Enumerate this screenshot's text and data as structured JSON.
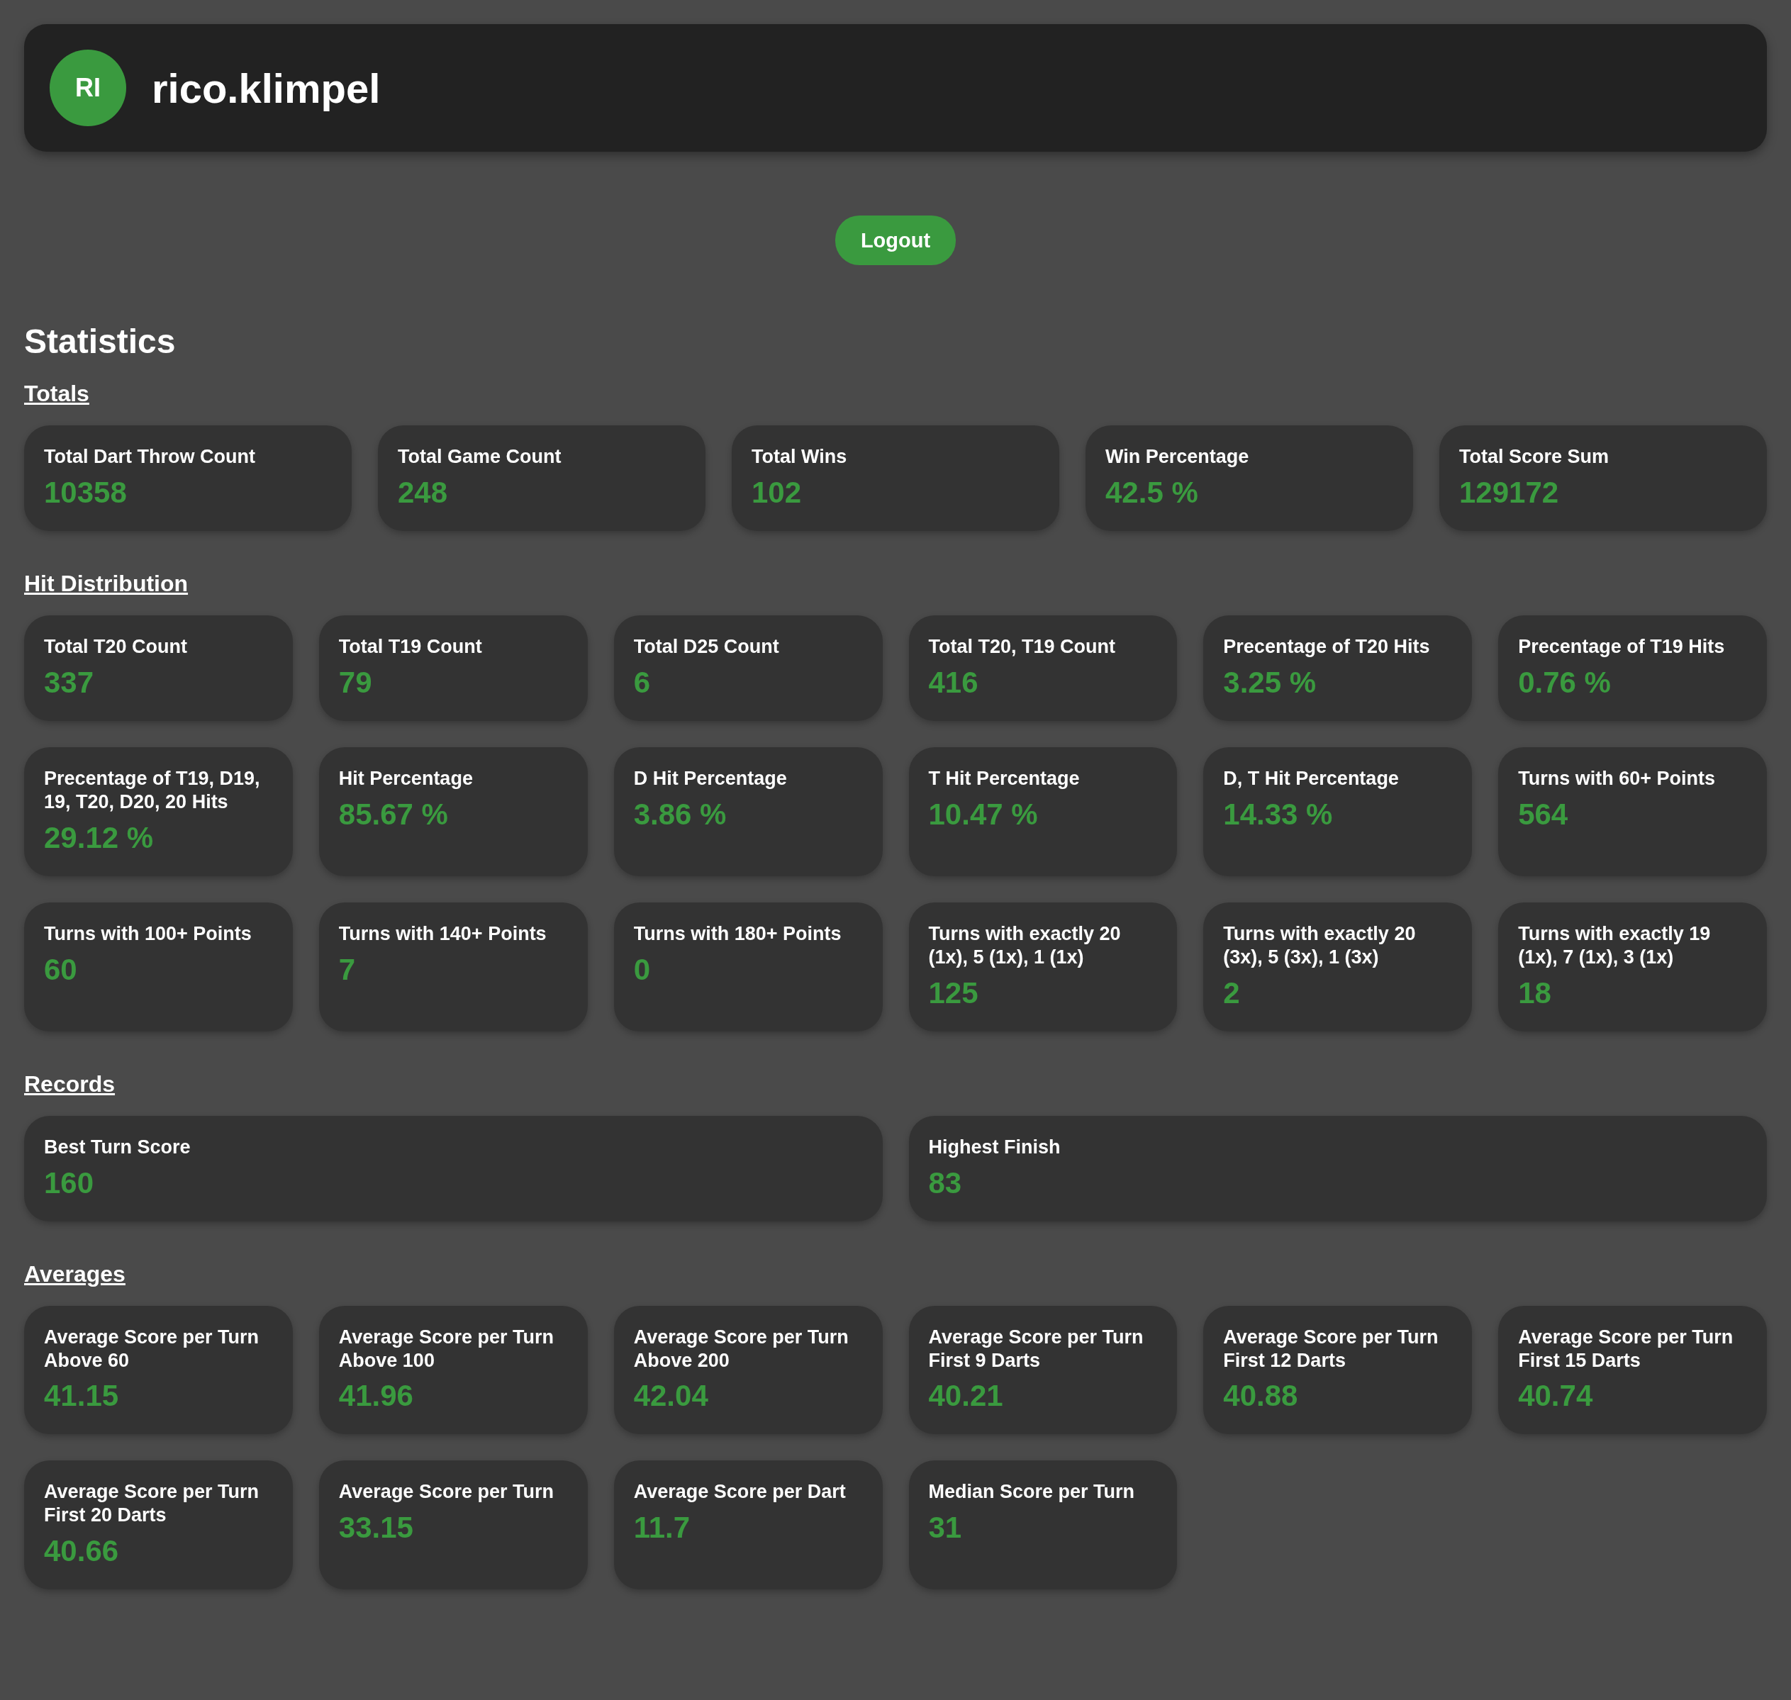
{
  "user": {
    "initials": "RI",
    "name": "rico.klimpel"
  },
  "logout": "Logout",
  "title": "Statistics",
  "sections": [
    {
      "title": "Totals",
      "cards": [
        {
          "label": "Total Dart Throw Count",
          "value": "10358"
        },
        {
          "label": "Total Game Count",
          "value": "248"
        },
        {
          "label": "Total Wins",
          "value": "102"
        },
        {
          "label": "Win Percentage",
          "value": "42.5 %"
        },
        {
          "label": "Total Score Sum",
          "value": "129172"
        }
      ]
    },
    {
      "title": "Hit Distribution",
      "cards": [
        {
          "label": "Total T20 Count",
          "value": "337"
        },
        {
          "label": "Total T19 Count",
          "value": "79"
        },
        {
          "label": "Total D25 Count",
          "value": "6"
        },
        {
          "label": "Total T20, T19 Count",
          "value": "416"
        },
        {
          "label": "Precentage of T20 Hits",
          "value": "3.25 %"
        },
        {
          "label": "Precentage of T19 Hits",
          "value": "0.76 %"
        },
        {
          "label": "Precentage of T19, D19, 19, T20, D20, 20 Hits",
          "value": "29.12 %"
        },
        {
          "label": "Hit Percentage",
          "value": "85.67 %"
        },
        {
          "label": "D Hit Percentage",
          "value": "3.86 %"
        },
        {
          "label": "T Hit Percentage",
          "value": "10.47 %"
        },
        {
          "label": "D, T Hit Percentage",
          "value": "14.33 %"
        },
        {
          "label": "Turns with 60+ Points",
          "value": "564"
        },
        {
          "label": "Turns with 100+ Points",
          "value": "60"
        },
        {
          "label": "Turns with 140+ Points",
          "value": "7"
        },
        {
          "label": "Turns with 180+ Points",
          "value": "0"
        },
        {
          "label": "Turns with exactly 20 (1x), 5 (1x), 1 (1x)",
          "value": "125"
        },
        {
          "label": "Turns with exactly 20 (3x), 5 (3x), 1 (3x)",
          "value": "2"
        },
        {
          "label": "Turns with exactly 19 (1x), 7 (1x), 3 (1x)",
          "value": "18"
        }
      ]
    },
    {
      "title": "Records",
      "cards": [
        {
          "label": "Best Turn Score",
          "value": "160"
        },
        {
          "label": "Highest Finish",
          "value": "83"
        }
      ]
    },
    {
      "title": "Averages",
      "cards": [
        {
          "label": "Average Score per Turn Above 60",
          "value": "41.15"
        },
        {
          "label": "Average Score per Turn Above 100",
          "value": "41.96"
        },
        {
          "label": "Average Score per Turn Above 200",
          "value": "42.04"
        },
        {
          "label": "Average Score per Turn First 9 Darts",
          "value": "40.21"
        },
        {
          "label": "Average Score per Turn First 12 Darts",
          "value": "40.88"
        },
        {
          "label": "Average Score per Turn First 15 Darts",
          "value": "40.74"
        },
        {
          "label": "Average Score per Turn First 20 Darts",
          "value": "40.66"
        },
        {
          "label": "Average Score per Turn",
          "value": "33.15"
        },
        {
          "label": "Average Score per Dart",
          "value": "11.7"
        },
        {
          "label": "Median Score per Turn",
          "value": "31"
        }
      ]
    }
  ]
}
